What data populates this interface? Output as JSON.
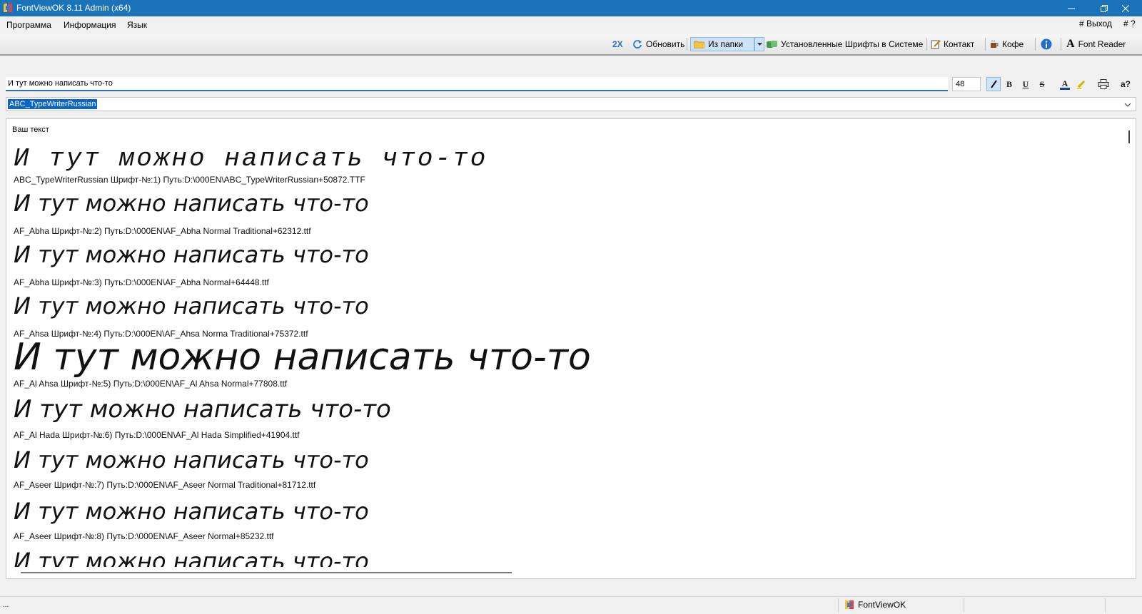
{
  "window": {
    "title": "FontViewOK 8.11 Admin (x64)"
  },
  "menu": {
    "items": [
      "Программа",
      "Информация",
      "Язык"
    ],
    "exit": "# Выход",
    "help": "# ?"
  },
  "toolbar": {
    "double": "2X",
    "refresh": "Обновить",
    "from_folder": "Из папки",
    "installed": "Установленные Шрифты в Системе",
    "contact": "Контакт",
    "coffee": "Кофе",
    "font_reader": "Font Reader"
  },
  "editor": {
    "text": "И тут можно написать что-то",
    "size": "48",
    "format_buttons": {
      "italic": "I",
      "bold": "B",
      "underline": "U",
      "strike": "S",
      "font_color": "A",
      "ask": "a?"
    }
  },
  "font_select": {
    "value": "ABC_TypeWriterRussian"
  },
  "preview": {
    "caption": "Ваш текст",
    "sample_text": "И тут можно написать что-то",
    "entries": [
      {
        "info": "ABC_TypeWriterRussian Шрифт-№:1) Путь:D:\\000EN\\ABC_TypeWriterRussian+50872.TTF"
      },
      {
        "info": "AF_Abha Шрифт-№:2) Путь:D:\\000EN\\AF_Abha Normal Traditional+62312.ttf"
      },
      {
        "info": "AF_Abha Шрифт-№:3) Путь:D:\\000EN\\AF_Abha Normal+64448.ttf"
      },
      {
        "info": "AF_Ahsa Шрифт-№:4) Путь:D:\\000EN\\AF_Ahsa Norma Traditional+75372.ttf"
      },
      {
        "info": "AF_Al Ahsa Шрифт-№:5) Путь:D:\\000EN\\AF_Al Ahsa Normal+77808.ttf"
      },
      {
        "info": "AF_Al Hada Шрифт-№:6) Путь:D:\\000EN\\AF_Al Hada Simplified+41904.ttf"
      },
      {
        "info": "AF_Aseer Шрифт-№:7) Путь:D:\\000EN\\AF_Aseer Normal Traditional+81712.ttf"
      },
      {
        "info": "AF_Aseer Шрифт-№:8) Путь:D:\\000EN\\AF_Aseer Normal+85232.ttf"
      }
    ]
  },
  "status": {
    "dots": "...",
    "app": "FontViewOK"
  }
}
